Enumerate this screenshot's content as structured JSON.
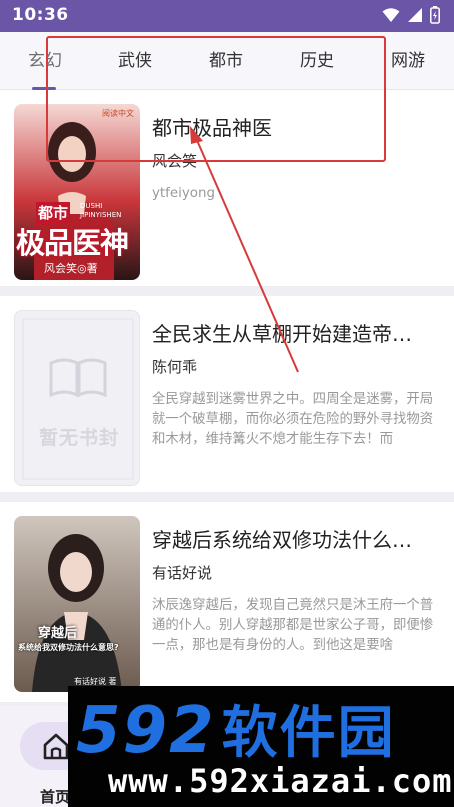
{
  "status": {
    "time": "10:36",
    "icons": [
      "wifi-icon",
      "signal-icon",
      "battery-icon"
    ]
  },
  "tabs": [
    {
      "label": "玄幻",
      "active": true
    },
    {
      "label": "武侠",
      "active": false
    },
    {
      "label": "都市",
      "active": false
    },
    {
      "label": "历史",
      "active": false
    },
    {
      "label": "网游",
      "active": false
    }
  ],
  "books": [
    {
      "title": "都市极品神医",
      "author": "风会笑",
      "desc": "ytfeiyong",
      "cover": {
        "top_text": "都市",
        "main_text": "极品医神",
        "pinyin": "DUSHI JIPINYISHEN",
        "author_tag": "风会笑◎著",
        "publisher": "阅读中文"
      }
    },
    {
      "title": "全民求生从草棚开始建造帝…",
      "author": "陈何乖",
      "desc": "全民穿越到迷雾世界之中。四周全是迷雾，开局就一个破草棚，而你必须在危险的野外寻找物资和木材，维持篝火不熄才能生存下去！而",
      "cover": {
        "placeholder": "暂无书封"
      }
    },
    {
      "title": "穿越后系统给双修功法什么…",
      "author": "有话好说",
      "desc": "沐辰逸穿越后，发现自己竟然只是沐王府一个普通的仆人。别人穿越那都是世家公子哥，即便惨一点，那也是有身份的人。到他这是要啥",
      "cover": {
        "line1": "穿越后",
        "line2": "系统给我双修功法什么意思?",
        "author_tag": "有话好说 著"
      }
    }
  ],
  "bottom_nav": {
    "home_label": "首页"
  },
  "watermark": {
    "brand": "592",
    "brand_cn": "软件园",
    "url": "www.592xiazai.com"
  },
  "colors": {
    "accent": "#6a55a7",
    "annotation": "#d63a3a",
    "watermark_blue": "#1f6fe0"
  }
}
